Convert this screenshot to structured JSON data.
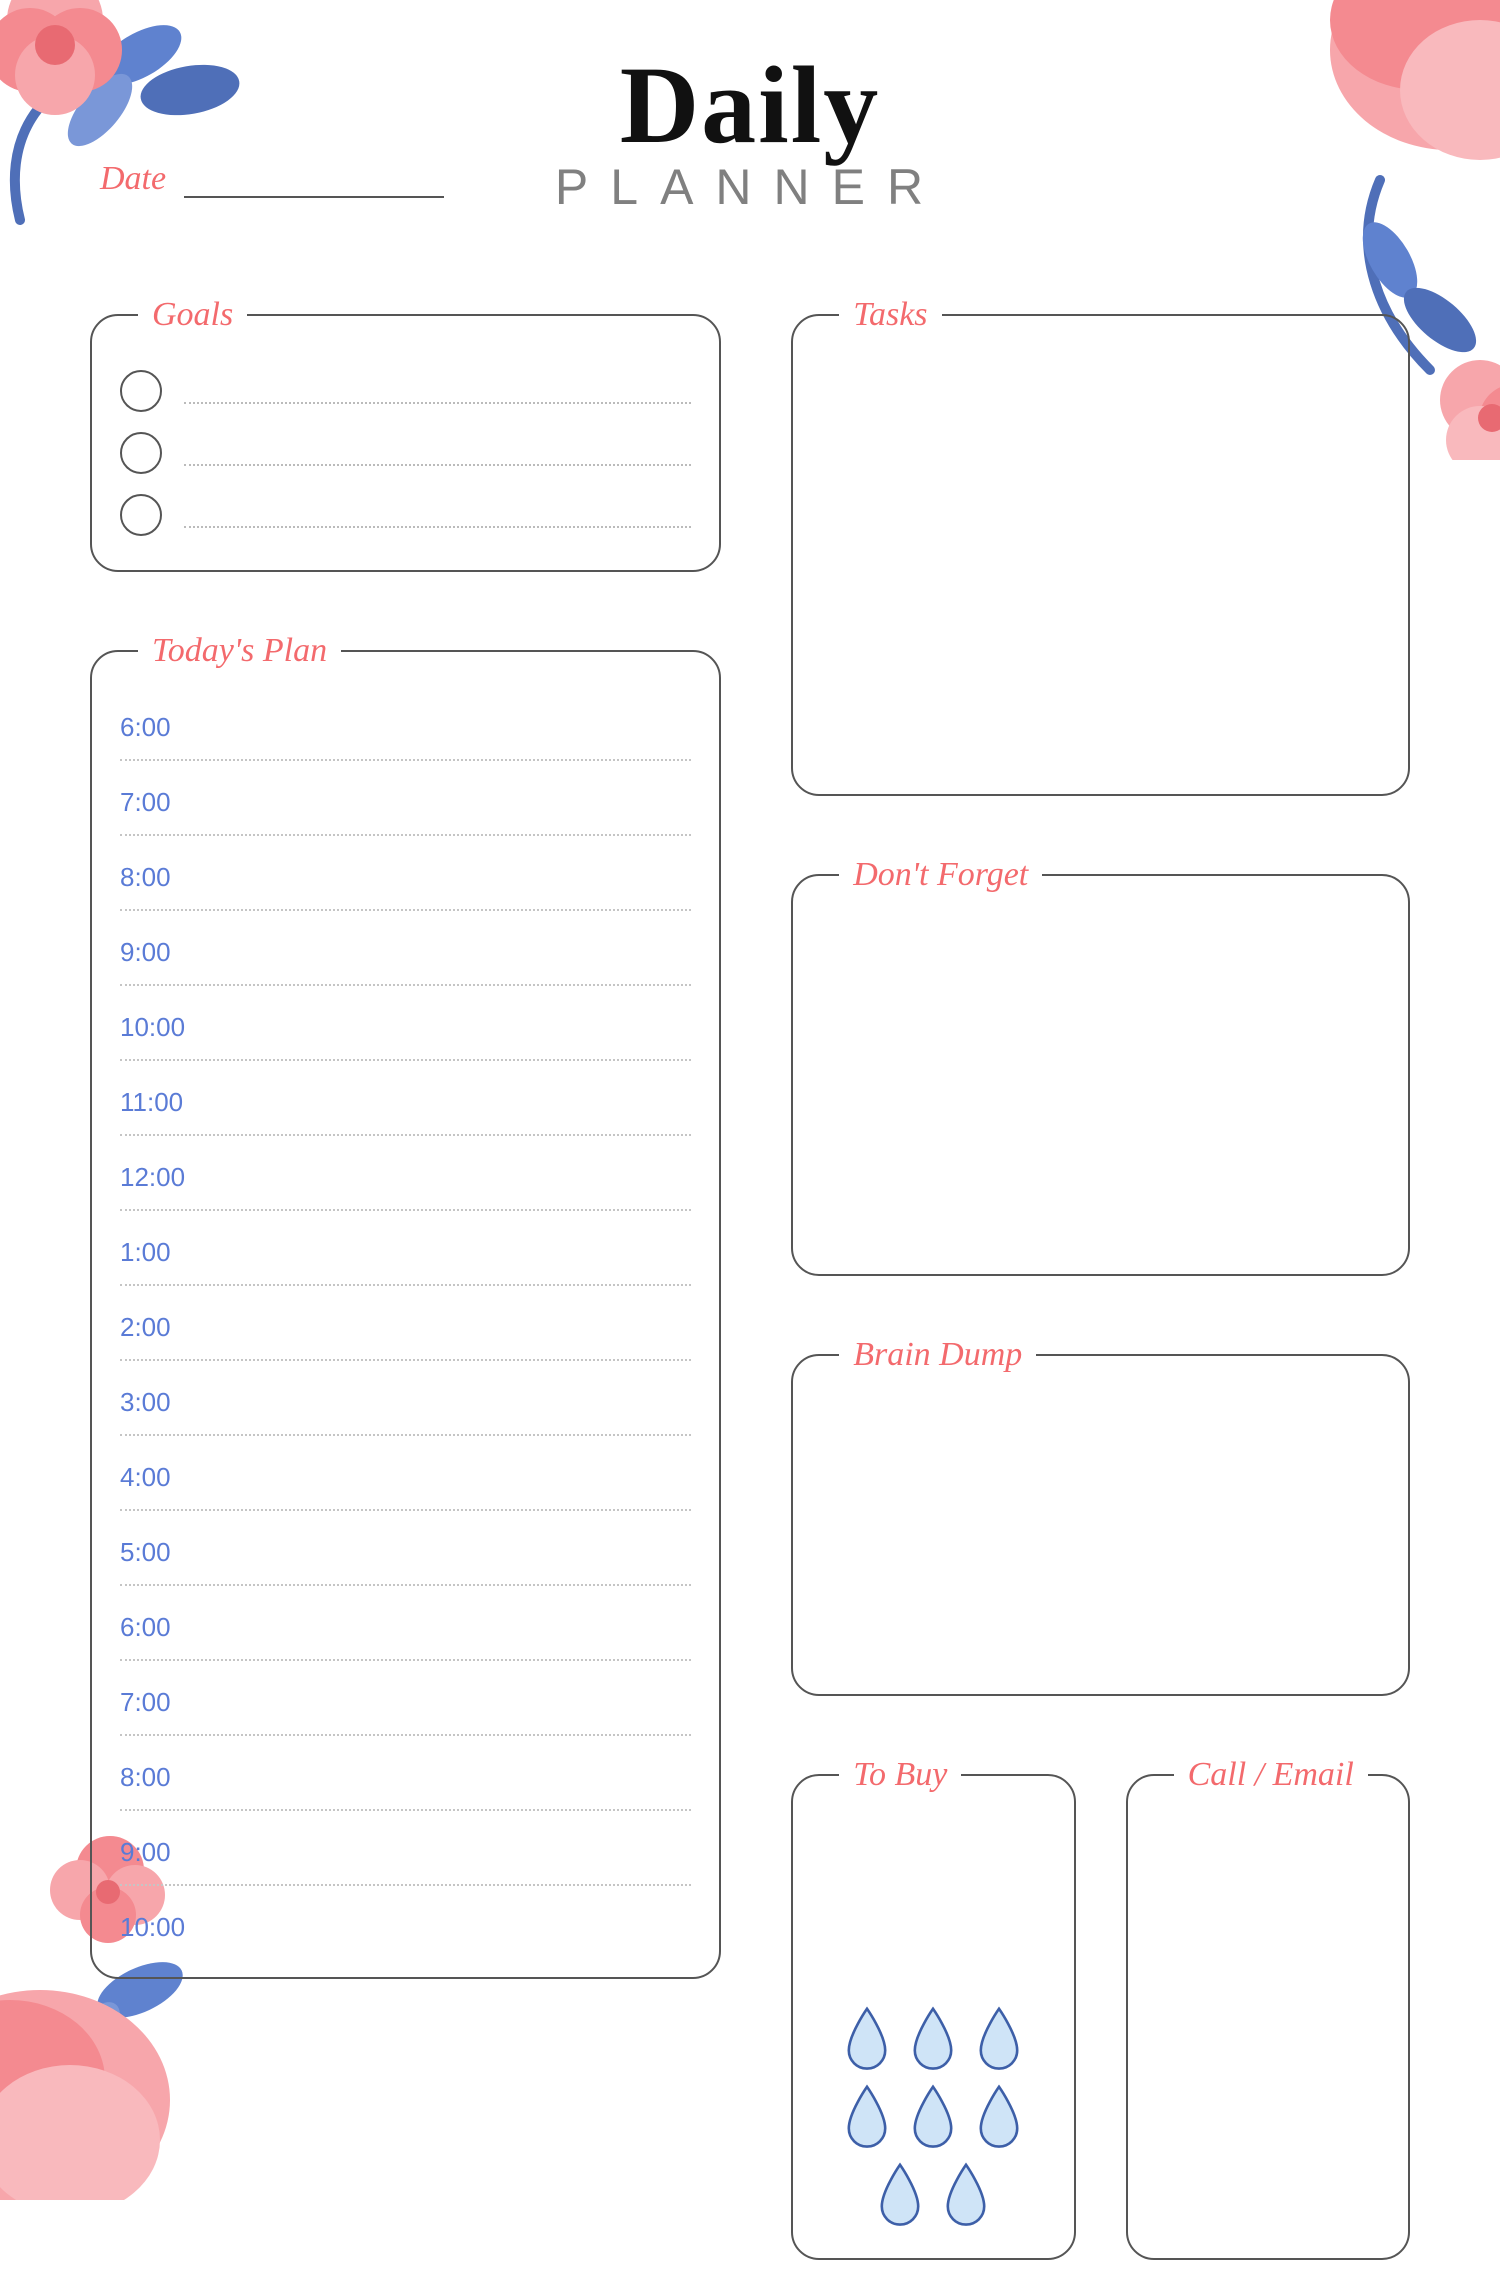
{
  "title": {
    "main": "Daily",
    "sub": "PLANNER"
  },
  "date": {
    "label": "Date",
    "value": ""
  },
  "sections": {
    "goals": {
      "label": "Goals",
      "items": [
        "",
        "",
        ""
      ]
    },
    "todays_plan": {
      "label": "Today's Plan",
      "slots": [
        "6:00",
        "7:00",
        "8:00",
        "9:00",
        "10:00",
        "11:00",
        "12:00",
        "1:00",
        "2:00",
        "3:00",
        "4:00",
        "5:00",
        "6:00",
        "7:00",
        "8:00",
        "9:00",
        "10:00"
      ]
    },
    "tasks": {
      "label": "Tasks"
    },
    "dont_forget": {
      "label": "Don't Forget"
    },
    "brain_dump": {
      "label": "Brain Dump"
    },
    "to_buy": {
      "label": "To Buy",
      "water_drops": 8
    },
    "call_email": {
      "label": "Call / Email"
    }
  },
  "colors": {
    "accent": "#f36a6d",
    "time": "#5a7bd6",
    "border": "#555555"
  }
}
